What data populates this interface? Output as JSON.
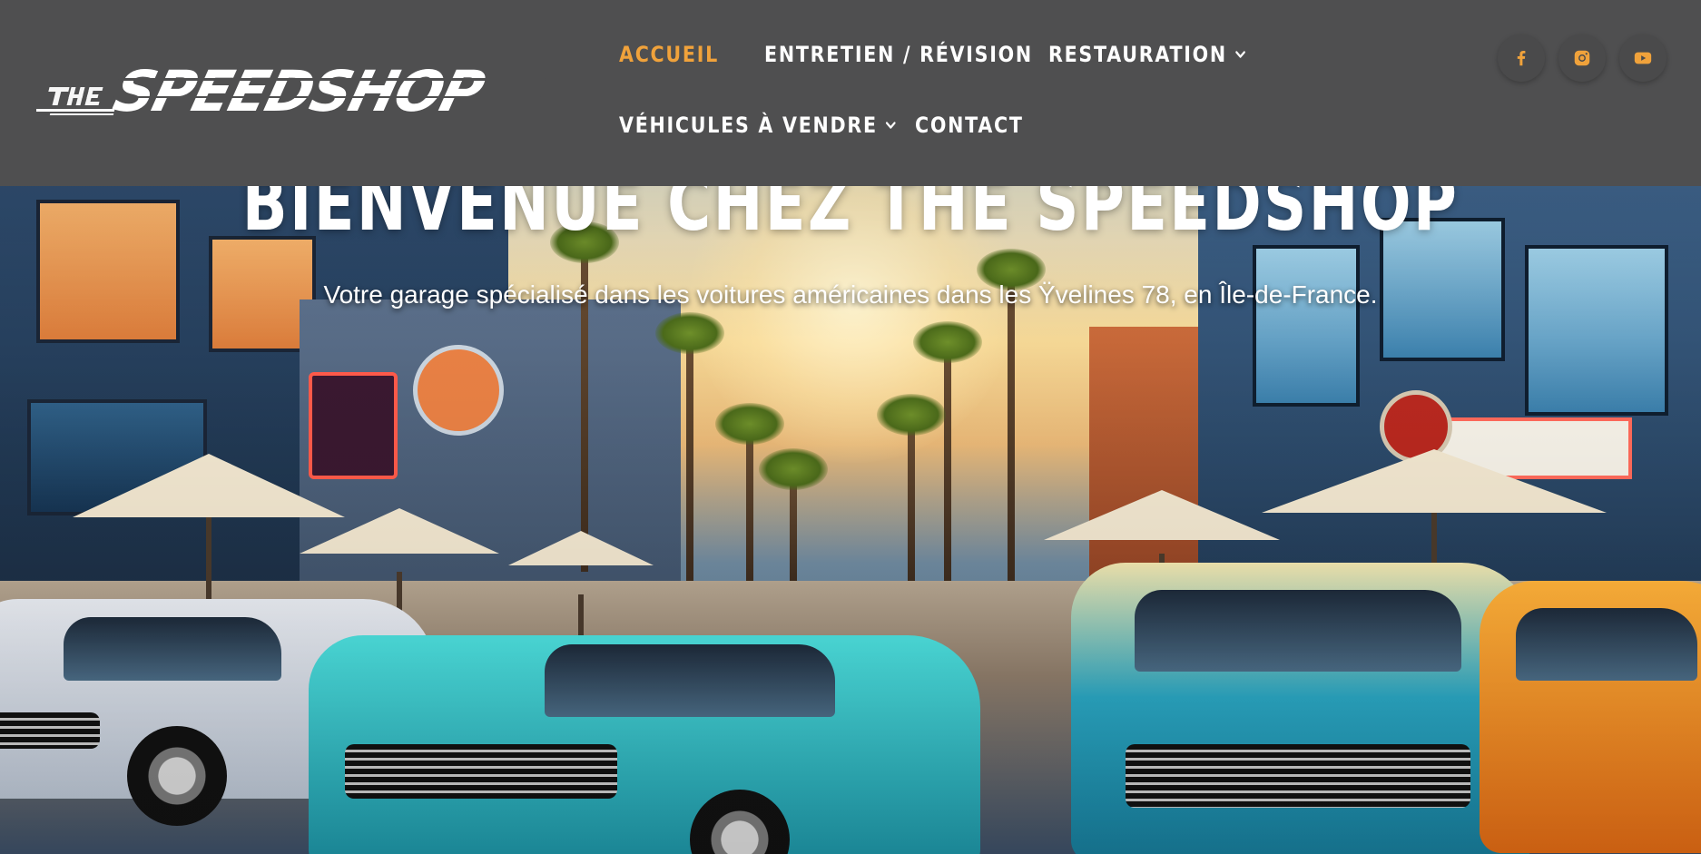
{
  "header": {
    "logo_alt": "THE SPEEDSHOP",
    "nav": [
      {
        "label": "ACCUEIL",
        "active": true,
        "has_dropdown": false
      },
      {
        "label": "ENTRETIEN / RÉVISION",
        "active": false,
        "has_dropdown": false
      },
      {
        "label": "RESTAURATION",
        "active": false,
        "has_dropdown": true
      },
      {
        "label": "VÉHICULES À VENDRE",
        "active": false,
        "has_dropdown": true
      },
      {
        "label": "CONTACT",
        "active": false,
        "has_dropdown": false
      }
    ],
    "social": [
      {
        "icon": "facebook-icon"
      },
      {
        "icon": "instagram-icon"
      },
      {
        "icon": "youtube-icon"
      }
    ]
  },
  "hero": {
    "title": "BIENVENUE CHEZ THE SPEEDSHOP",
    "subtitle": "Votre garage spécialisé dans les voitures américaines dans les Ÿvelines 78, en Île-de-France."
  },
  "colors": {
    "header_bg": "#4f4f50",
    "accent": "#f0a23b",
    "nav_text": "#ffffff",
    "social_icon": "#f0a23b"
  }
}
